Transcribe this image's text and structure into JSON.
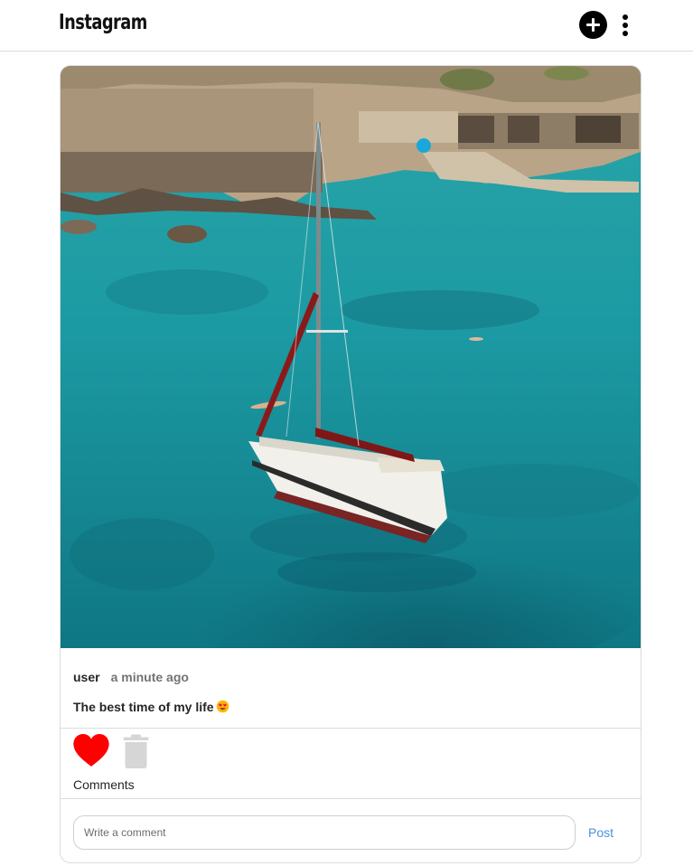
{
  "header": {
    "app_title": "Instagram",
    "add_icon": "plus-circle-icon",
    "more_icon": "vertical-dots-icon"
  },
  "post": {
    "image_icon": "sailboat-photo",
    "username": "user",
    "timestamp": "a minute ago",
    "caption": "The best time of my life",
    "caption_emoji": "heart-eyes-emoji",
    "liked": true,
    "like_icon": "heart-icon",
    "delete_icon": "trash-icon",
    "comments_label": "Comments",
    "comment_input": {
      "value": "",
      "placeholder": "Write a comment"
    },
    "post_label": "Post"
  },
  "colors": {
    "heart": "#ff0000",
    "trash": "#d6d6d6",
    "post_link": "#4a90e2",
    "sea": "#1f9aa5"
  }
}
